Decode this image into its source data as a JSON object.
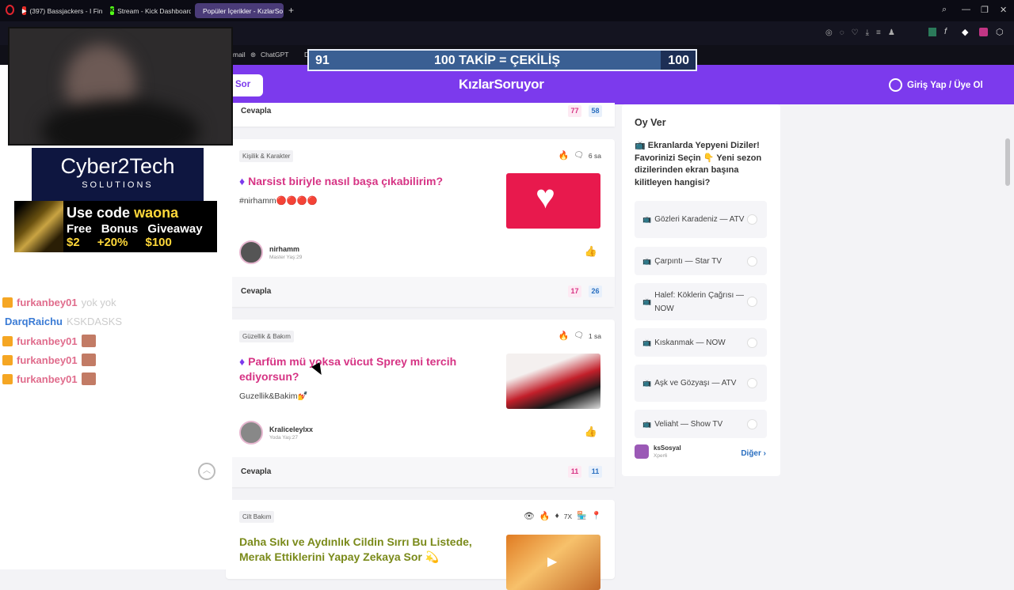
{
  "browser": {
    "tabs": [
      {
        "title": "(397) Bassjackers - I Fink U",
        "icon": "youtube-icon",
        "color": "#e52d27"
      },
      {
        "title": "Stream - Kick Dashboard",
        "icon": "kick-icon",
        "color": "#53fc18"
      },
      {
        "title": "Popüler İçerikler - KızlarSo",
        "icon": "kizlarsoruyor-icon",
        "color": "#7c3aed"
      }
    ],
    "new_tab": "+",
    "bookmarks": [
      "mail",
      "ChatGPT",
      "D"
    ]
  },
  "stream_overlay": {
    "progress": {
      "current": "91",
      "label": "100 TAKİP = ÇEKİLİŞ",
      "goal": "100",
      "fraction": 0.91
    },
    "sponsor": {
      "name": "Cyber2Tech",
      "sub": "SOLUTIONS"
    },
    "promo": {
      "prefix": "Use code",
      "code": "waona",
      "col1": [
        "Free",
        "$2"
      ],
      "col2": [
        "Bonus",
        "+20%"
      ],
      "col3": [
        "Giveaway",
        "$100"
      ]
    },
    "chat": [
      {
        "user": "furkanbey01",
        "color": "#e06c8c",
        "msg": "yok yok",
        "badge": true,
        "emote": false
      },
      {
        "user": "DarqRaichu",
        "color": "#3a7bd5",
        "msg": "KSKDASKS",
        "badge": false,
        "emote": false
      },
      {
        "user": "furkanbey01",
        "color": "#e06c8c",
        "msg": "",
        "badge": true,
        "emote": true
      },
      {
        "user": "furkanbey01",
        "color": "#e06c8c",
        "msg": "",
        "badge": true,
        "emote": true
      },
      {
        "user": "furkanbey01",
        "color": "#e06c8c",
        "msg": "",
        "badge": true,
        "emote": true
      }
    ]
  },
  "site": {
    "logo": "KızlarSoruyor",
    "ask": "Sor",
    "login": "Giriş Yap / Üye Ol",
    "accent": "#7c3aed"
  },
  "feed": {
    "top_row": {
      "answer": "Cevapla",
      "count1": "77",
      "count2": "58"
    },
    "cards": [
      {
        "category": "Kişilik & Karakter",
        "time": "6 sa",
        "title": "Narsist biriyle nasıl başa çıkabilirim?",
        "desc": "#nirhamm🔴🔴🔴🔴",
        "user": "nirhamm",
        "rank": "Master Yaş:29",
        "answer": "Cevapla",
        "count1": "17",
        "count2": "26"
      },
      {
        "category": "Güzellik & Bakım",
        "time": "1 sa",
        "title": "Parfüm mü yoksa vücut Sprey mi tercih ediyorsun?",
        "desc": "Guzellik&Bakim💅",
        "user": "Kraliceleylxx",
        "rank": "Yoda Yaş:27",
        "answer": "Cevapla",
        "count1": "11",
        "count2": "11"
      },
      {
        "category": "Cilt Bakım",
        "badge_count": "7X",
        "title": "Daha Sıkı ve Aydınlık Cildin Sırrı Bu Listede, Merak Ettiklerini Yapay Zekaya Sor 💫"
      }
    ]
  },
  "poll": {
    "heading": "Oy Ver",
    "question": "📺 Ekranlarda Yepyeni Diziler! Favorinizi Seçin 👇 Yeni sezon dizilerinden ekran başına kilitleyen hangisi?",
    "options": [
      "Gözleri Karadeniz — ATV",
      "Çarpıntı — Star TV",
      "Halef: Köklerin Çağrısı — NOW",
      "Kıskanmak — NOW",
      "Aşk ve Gözyaşı — ATV",
      "Veliaht — Show TV"
    ],
    "author": "ksSosyal",
    "author_rank": "Xper6",
    "more": "Diğer"
  }
}
